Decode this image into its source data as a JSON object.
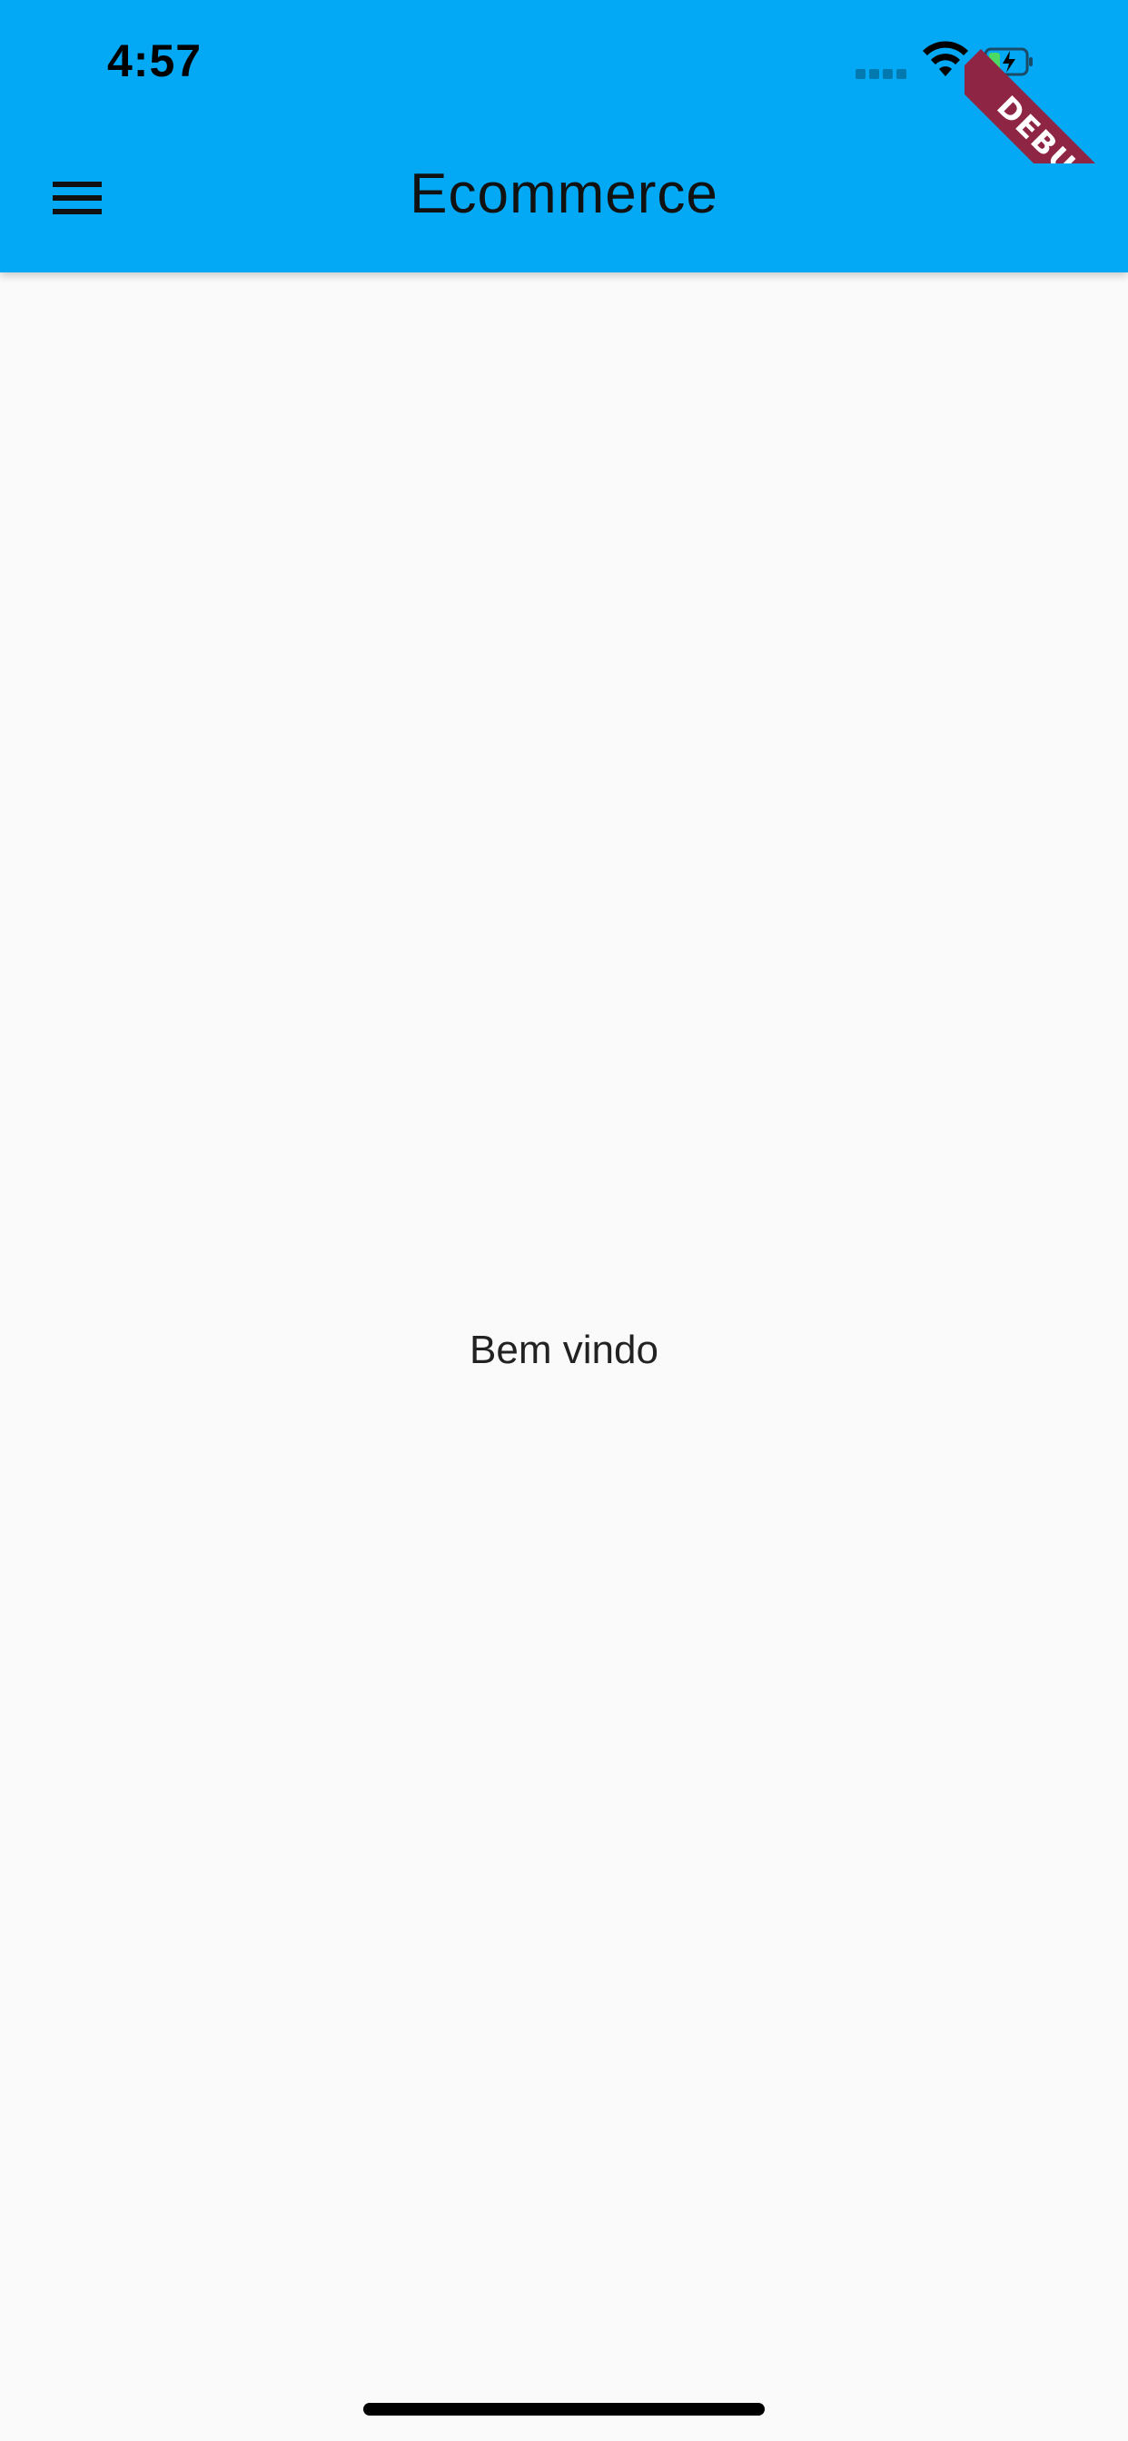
{
  "status_bar": {
    "time": "4:57",
    "icons": [
      "signal-icon",
      "wifi-icon",
      "battery-charging-icon"
    ]
  },
  "app_bar": {
    "title": "Ecommerce",
    "menu_icon": "hamburger-menu-icon",
    "background_color": "#03a9f4"
  },
  "debug_banner": {
    "label": "DEBUG",
    "color": "#8e2545"
  },
  "body": {
    "welcome_text": "Bem vindo",
    "background_color": "#fafafa"
  }
}
